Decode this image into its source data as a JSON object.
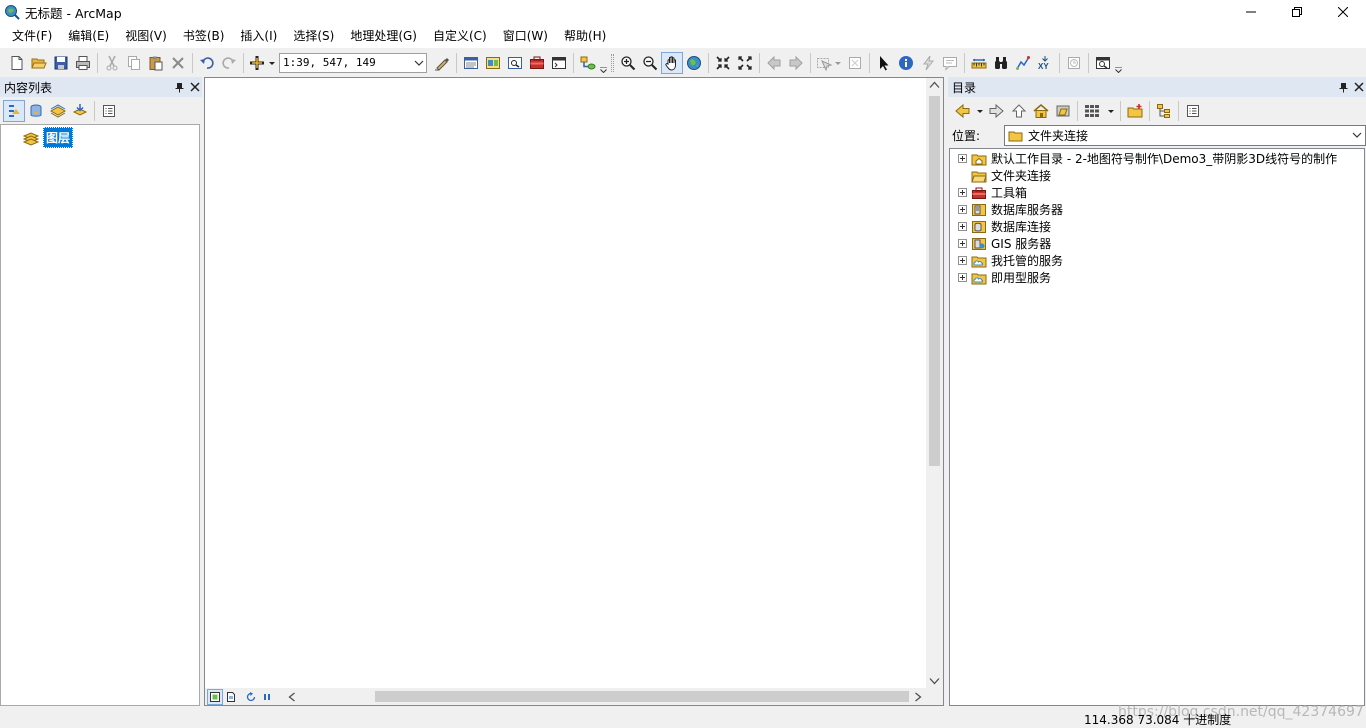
{
  "window": {
    "title": "无标题 - ArcMap"
  },
  "menu": [
    "文件(F)",
    "编辑(E)",
    "视图(V)",
    "书签(B)",
    "插入(I)",
    "选择(S)",
    "地理处理(G)",
    "自定义(C)",
    "窗口(W)",
    "帮助(H)"
  ],
  "toolbar": {
    "scale": "1:39, 547, 149"
  },
  "toc": {
    "title": "内容列表",
    "layer_group": "图层"
  },
  "catalog": {
    "title": "目录",
    "location_label": "位置:",
    "location_value": "文件夹连接",
    "tree": [
      "默认工作目录 - 2-地图符号制作\\Demo3_带阴影3D线符号的制作",
      "文件夹连接",
      "工具箱",
      "数据库服务器",
      "数据库连接",
      "GIS 服务器",
      "我托管的服务",
      "即用型服务"
    ]
  },
  "status": {
    "x": "114.368",
    "y": "73.084",
    "units": "十进制度",
    "watermark": "https://blog.csdn.net/qq_42374697"
  }
}
